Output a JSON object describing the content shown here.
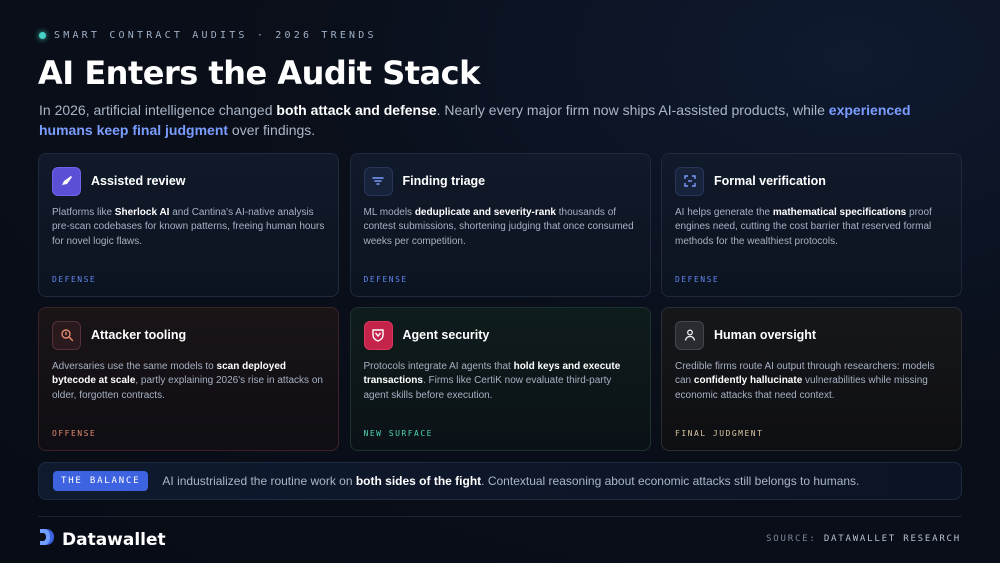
{
  "header": {
    "eyebrow": "SMART CONTRACT AUDITS · 2026 TRENDS",
    "title": "AI Enters the Audit Stack",
    "intro": {
      "t1": "In 2026, artificial intelligence changed ",
      "b1": "both attack and defense",
      "t2": ". Nearly every major firm now ships AI-assisted products, while ",
      "h1": "experienced humans keep final judgment",
      "t3": " over findings."
    }
  },
  "cards": [
    {
      "title": "Assisted review",
      "icon": "pen-icon",
      "body": {
        "t1": "Platforms like ",
        "b1": "Sherlock AI",
        "t2": " and Cantina's AI-native analysis pre-scan codebases for known patterns, freeing human hours for novel logic flaws.",
        "b2": "",
        "t3": ""
      },
      "tag": "DEFENSE",
      "tag_color": "#5f86f0"
    },
    {
      "title": "Finding triage",
      "icon": "filter-icon",
      "body": {
        "t1": "ML models ",
        "b1": "deduplicate and severity-rank",
        "t2": " thousands of contest submissions, shortening judging that once consumed weeks per competition.",
        "b2": "",
        "t3": ""
      },
      "tag": "DEFENSE",
      "tag_color": "#5f86f0"
    },
    {
      "title": "Formal verification",
      "icon": "scan-frame-icon",
      "body": {
        "t1": "AI helps generate the ",
        "b1": "mathematical specifications",
        "t2": " proof engines need, cutting the cost barrier that reserved formal methods for the wealthiest protocols.",
        "b2": "",
        "t3": ""
      },
      "tag": "DEFENSE",
      "tag_color": "#5f86f0"
    },
    {
      "title": "Attacker tooling",
      "icon": "search-icon",
      "body": {
        "t1": "Adversaries use the same models to ",
        "b1": "scan deployed bytecode at scale",
        "t2": ", partly explaining 2026's rise in attacks on older, forgotten contracts.",
        "b2": "",
        "t3": ""
      },
      "tag": "OFFENSE",
      "tag_color": "#e58a6d"
    },
    {
      "title": "Agent security",
      "icon": "shield-icon",
      "body": {
        "t1": "Protocols integrate AI agents that ",
        "b1": "hold keys and execute transactions",
        "t2": ". Firms like CertiK now evaluate third-party agent skills before execution.",
        "b2": "",
        "t3": ""
      },
      "tag": "NEW SURFACE",
      "tag_color": "#4fd3b8"
    },
    {
      "title": "Human oversight",
      "icon": "person-icon",
      "body": {
        "t1": "Credible firms route AI output through researchers: models can ",
        "b1": "confidently hallucinate",
        "t2": " vulnerabilities while missing economic attacks that need context.",
        "b2": "",
        "t3": ""
      },
      "tag": "FINAL JUDGMENT",
      "tag_color": "#d9c59a"
    }
  ],
  "balance": {
    "badge": "THE BALANCE",
    "t1": "AI industrialized the routine work on ",
    "b1": "both sides of the fight",
    "t2": ". Contextual reasoning about economic attacks still belongs to humans."
  },
  "footer": {
    "brand": "Datawallet",
    "brand_icon": "datawallet-logo-icon",
    "source_label": "SOURCE:",
    "source_value": "DATAWALLET RESEARCH"
  },
  "colors": {
    "accent_blue": "#3d63e0",
    "teal": "#47d3c7",
    "background": "#0a0f1a"
  }
}
